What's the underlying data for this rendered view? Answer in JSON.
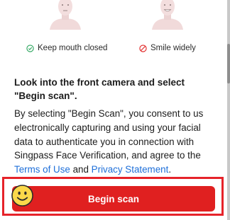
{
  "tips": [
    {
      "label": "Keep mouth closed",
      "icon": "check-circle-icon",
      "color": "#27a35a"
    },
    {
      "label": "Smile widely",
      "icon": "prohibited-icon",
      "color": "#e02020"
    }
  ],
  "instruction": "Look into the front camera and select \"Begin scan\".",
  "consent": {
    "text_before": "By selecting \"Begin Scan\", you consent to us electronically capturing and using your facial data to authenticate you in connection with Singpass Face Verification, and agree to the ",
    "terms_link": "Terms of Use",
    "joiner": " and ",
    "privacy_link": "Privacy Statement",
    "text_after": "."
  },
  "begin_button": {
    "label": "Begin scan",
    "color": "#e02020"
  },
  "highlight_color": "#e6232a",
  "link_color": "#1e6fd9"
}
